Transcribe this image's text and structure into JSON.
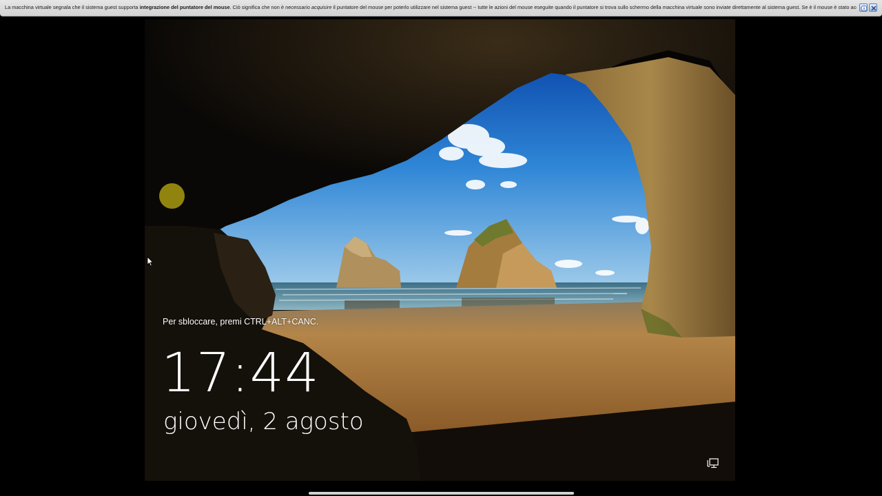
{
  "notification": {
    "text_before": "La macchina virtuale segnala che il sistema guest supporta ",
    "text_bold": "integrazione del puntatore del mouse",
    "text_middle": ". Ciò significa che non è necessario ",
    "text_italic": "acquisire",
    "text_after": " il puntatore del mouse per poterlo utilizzare nel sistema guest -- tutte le azioni del mouse eseguite quando il puntatore si trova sullo schermo della macchina virtuale sono inviate direttamente al sistema guest. Se è il mouse è stato acquisito,",
    "help_icon": "info-icon",
    "close_icon": "close-icon"
  },
  "lockscreen": {
    "unlock_hint": "Per sbloccare, premi CTRL+ALT+CANC.",
    "time": "17:44",
    "date": "giovedì, 2 agosto",
    "network_icon": "network-icon"
  },
  "colors": {
    "notification_bg": "#dcdcdc",
    "sky": "#2a7fd4",
    "sand": "#b07a3c",
    "cursor_highlight": "#a89a12"
  }
}
